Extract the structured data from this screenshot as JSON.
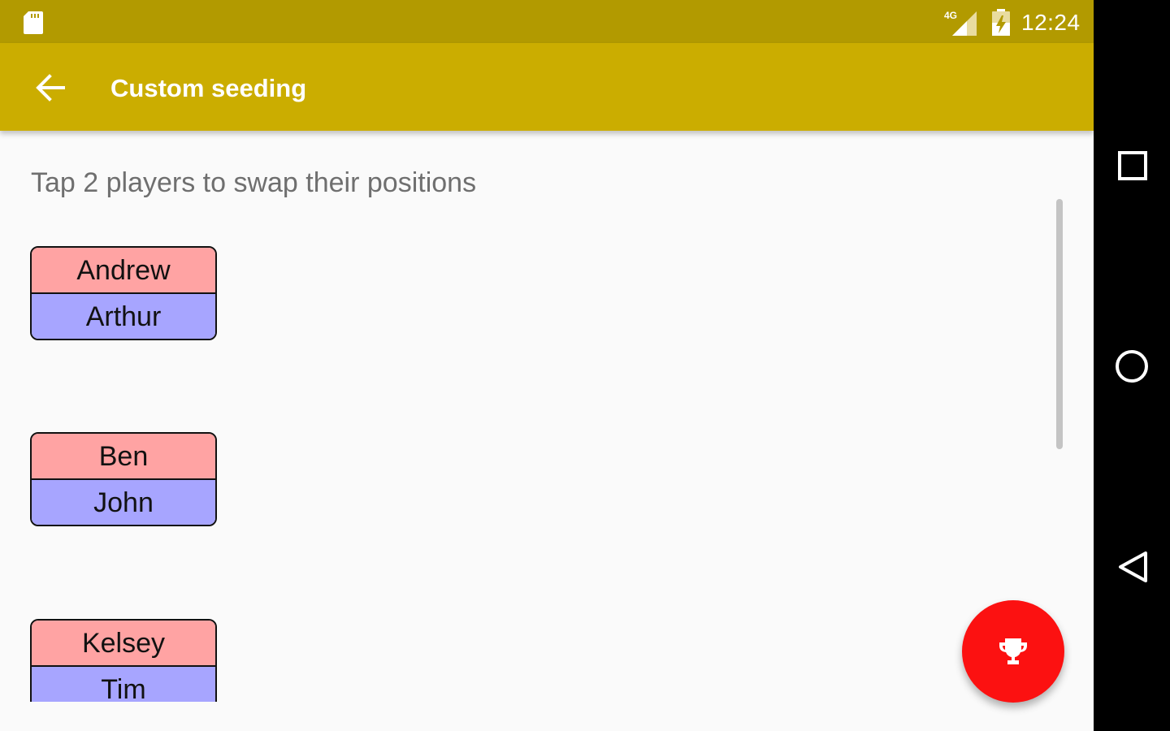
{
  "status_bar": {
    "network_label": "4G",
    "time": "12:24",
    "icons": [
      "sd-card-icon",
      "signal-4g-icon",
      "battery-charging-icon"
    ]
  },
  "toolbar": {
    "back_icon": "arrow-back-icon",
    "title": "Custom seeding"
  },
  "main": {
    "instruction": "Tap 2 players to swap their positions",
    "pairs": [
      {
        "top": "Andrew",
        "bottom": "Arthur"
      },
      {
        "top": "Ben",
        "bottom": "John"
      },
      {
        "top": "Kelsey",
        "bottom": "Tim"
      }
    ]
  },
  "fab": {
    "icon": "trophy-icon"
  },
  "navigation_bar": {
    "buttons": [
      "recents-square-icon",
      "home-circle-icon",
      "back-triangle-icon"
    ]
  },
  "colors": {
    "status_bar": "#b29a00",
    "toolbar": "#cbad00",
    "player_top": "#ffa3a3",
    "player_bottom": "#a7a5ff",
    "fab": "#fc1111",
    "background": "#fafafa"
  }
}
